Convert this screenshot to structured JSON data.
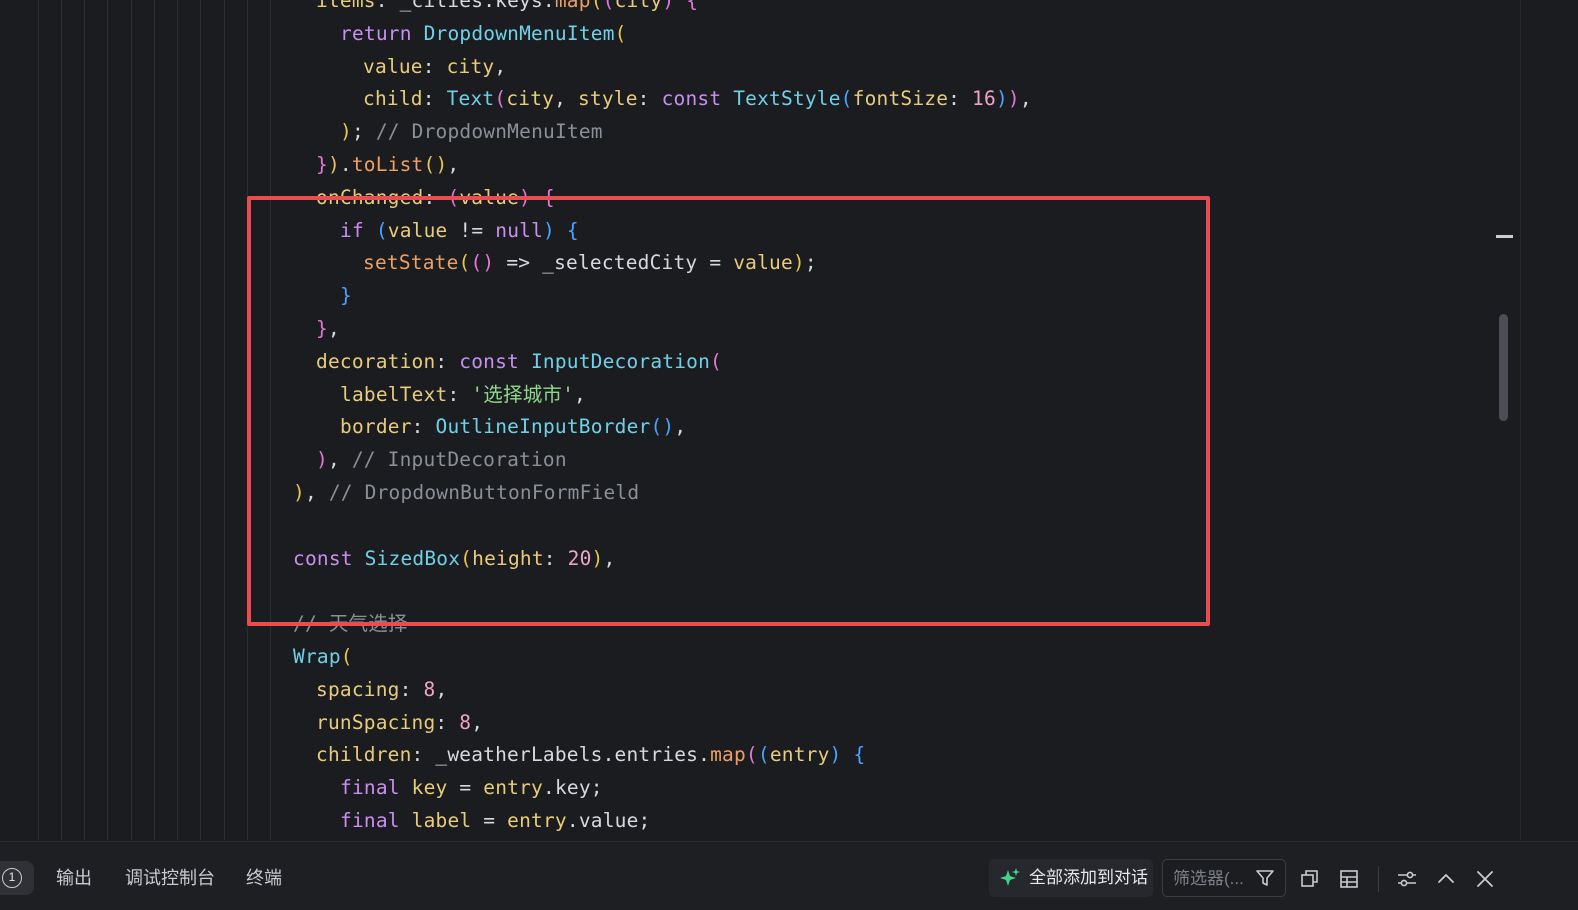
{
  "code_lines": [
    {
      "indent": 316,
      "tokens": [
        {
          "t": "items",
          "c": "prop"
        },
        {
          "t": ": ",
          "c": "id"
        },
        {
          "t": "_cities",
          "c": "id"
        },
        {
          "t": ".",
          "c": "id"
        },
        {
          "t": "keys",
          "c": "id"
        },
        {
          "t": ".",
          "c": "id"
        },
        {
          "t": "map",
          "c": "fn"
        },
        {
          "t": "(",
          "c": "p1"
        },
        {
          "t": "(",
          "c": "p2"
        },
        {
          "t": "city",
          "c": "prop"
        },
        {
          "t": ")",
          "c": "p2"
        },
        {
          "t": " ",
          "c": "id"
        },
        {
          "t": "{",
          "c": "p2"
        }
      ]
    },
    {
      "indent": 340,
      "tokens": [
        {
          "t": "return ",
          "c": "kw"
        },
        {
          "t": "DropdownMenuItem",
          "c": "ty"
        },
        {
          "t": "(",
          "c": "p1"
        }
      ]
    },
    {
      "indent": 363,
      "tokens": [
        {
          "t": "value",
          "c": "prop"
        },
        {
          "t": ": ",
          "c": "id"
        },
        {
          "t": "city",
          "c": "prop"
        },
        {
          "t": ",",
          "c": "id"
        }
      ]
    },
    {
      "indent": 363,
      "tokens": [
        {
          "t": "child",
          "c": "prop"
        },
        {
          "t": ": ",
          "c": "id"
        },
        {
          "t": "Text",
          "c": "ty"
        },
        {
          "t": "(",
          "c": "p2"
        },
        {
          "t": "city",
          "c": "prop"
        },
        {
          "t": ", ",
          "c": "id"
        },
        {
          "t": "style",
          "c": "prop"
        },
        {
          "t": ": ",
          "c": "id"
        },
        {
          "t": "const ",
          "c": "kw"
        },
        {
          "t": "TextStyle",
          "c": "ty"
        },
        {
          "t": "(",
          "c": "p3"
        },
        {
          "t": "fontSize",
          "c": "prop"
        },
        {
          "t": ": ",
          "c": "id"
        },
        {
          "t": "16",
          "c": "num"
        },
        {
          "t": ")",
          "c": "p3"
        },
        {
          "t": ")",
          "c": "p2"
        },
        {
          "t": ",",
          "c": "id"
        }
      ]
    },
    {
      "indent": 340,
      "tokens": [
        {
          "t": ")",
          "c": "p1"
        },
        {
          "t": "; ",
          "c": "id"
        },
        {
          "t": "// DropdownMenuItem",
          "c": "cm"
        }
      ]
    },
    {
      "indent": 316,
      "tokens": [
        {
          "t": "}",
          "c": "p2"
        },
        {
          "t": ")",
          "c": "p1"
        },
        {
          "t": ".",
          "c": "id"
        },
        {
          "t": "toList",
          "c": "fn"
        },
        {
          "t": "()",
          "c": "p1"
        },
        {
          "t": ",",
          "c": "id"
        }
      ]
    },
    {
      "indent": 316,
      "tokens": [
        {
          "t": "onChanged",
          "c": "prop"
        },
        {
          "t": ": ",
          "c": "id"
        },
        {
          "t": "(",
          "c": "p2"
        },
        {
          "t": "value",
          "c": "prop"
        },
        {
          "t": ")",
          "c": "p2"
        },
        {
          "t": " ",
          "c": "id"
        },
        {
          "t": "{",
          "c": "p2"
        }
      ]
    },
    {
      "indent": 340,
      "tokens": [
        {
          "t": "if ",
          "c": "kw"
        },
        {
          "t": "(",
          "c": "p3"
        },
        {
          "t": "value",
          "c": "prop"
        },
        {
          "t": " != ",
          "c": "id"
        },
        {
          "t": "null",
          "c": "kw"
        },
        {
          "t": ")",
          "c": "p3"
        },
        {
          "t": " ",
          "c": "id"
        },
        {
          "t": "{",
          "c": "p3"
        }
      ]
    },
    {
      "indent": 363,
      "tokens": [
        {
          "t": "setState",
          "c": "fn"
        },
        {
          "t": "(",
          "c": "p1"
        },
        {
          "t": "()",
          "c": "p2"
        },
        {
          "t": " => ",
          "c": "id"
        },
        {
          "t": "_selectedCity",
          "c": "id"
        },
        {
          "t": " = ",
          "c": "id"
        },
        {
          "t": "value",
          "c": "prop"
        },
        {
          "t": ")",
          "c": "p1"
        },
        {
          "t": ";",
          "c": "id"
        }
      ]
    },
    {
      "indent": 340,
      "tokens": [
        {
          "t": "}",
          "c": "p3"
        }
      ]
    },
    {
      "indent": 316,
      "tokens": [
        {
          "t": "}",
          "c": "p2"
        },
        {
          "t": ",",
          "c": "id"
        }
      ]
    },
    {
      "indent": 316,
      "tokens": [
        {
          "t": "decoration",
          "c": "prop"
        },
        {
          "t": ": ",
          "c": "id"
        },
        {
          "t": "const ",
          "c": "kw"
        },
        {
          "t": "InputDecoration",
          "c": "ty"
        },
        {
          "t": "(",
          "c": "p2"
        }
      ]
    },
    {
      "indent": 340,
      "tokens": [
        {
          "t": "labelText",
          "c": "prop"
        },
        {
          "t": ": ",
          "c": "id"
        },
        {
          "t": "'选择城市'",
          "c": "str"
        },
        {
          "t": ",",
          "c": "id"
        }
      ]
    },
    {
      "indent": 340,
      "tokens": [
        {
          "t": "border",
          "c": "prop"
        },
        {
          "t": ": ",
          "c": "id"
        },
        {
          "t": "OutlineInputBorder",
          "c": "ty"
        },
        {
          "t": "()",
          "c": "p3"
        },
        {
          "t": ",",
          "c": "id"
        }
      ]
    },
    {
      "indent": 316,
      "tokens": [
        {
          "t": ")",
          "c": "p2"
        },
        {
          "t": ", ",
          "c": "id"
        },
        {
          "t": "// InputDecoration",
          "c": "cm"
        }
      ]
    },
    {
      "indent": 293,
      "tokens": [
        {
          "t": ")",
          "c": "p1"
        },
        {
          "t": ", ",
          "c": "id"
        },
        {
          "t": "// DropdownButtonFormField",
          "c": "cm"
        }
      ]
    },
    {
      "indent": 293,
      "tokens": []
    },
    {
      "indent": 293,
      "tokens": [
        {
          "t": "const ",
          "c": "kw"
        },
        {
          "t": "SizedBox",
          "c": "ty"
        },
        {
          "t": "(",
          "c": "p1"
        },
        {
          "t": "height",
          "c": "prop"
        },
        {
          "t": ": ",
          "c": "id"
        },
        {
          "t": "20",
          "c": "num"
        },
        {
          "t": ")",
          "c": "p1"
        },
        {
          "t": ",",
          "c": "id"
        }
      ]
    },
    {
      "indent": 293,
      "tokens": []
    },
    {
      "indent": 293,
      "tokens": [
        {
          "t": "// 天气选择",
          "c": "cm"
        }
      ]
    },
    {
      "indent": 293,
      "tokens": [
        {
          "t": "Wrap",
          "c": "ty"
        },
        {
          "t": "(",
          "c": "p1"
        }
      ]
    },
    {
      "indent": 316,
      "tokens": [
        {
          "t": "spacing",
          "c": "prop"
        },
        {
          "t": ": ",
          "c": "id"
        },
        {
          "t": "8",
          "c": "num"
        },
        {
          "t": ",",
          "c": "id"
        }
      ]
    },
    {
      "indent": 316,
      "tokens": [
        {
          "t": "runSpacing",
          "c": "prop"
        },
        {
          "t": ": ",
          "c": "id"
        },
        {
          "t": "8",
          "c": "num"
        },
        {
          "t": ",",
          "c": "id"
        }
      ]
    },
    {
      "indent": 316,
      "tokens": [
        {
          "t": "children",
          "c": "prop"
        },
        {
          "t": ": ",
          "c": "id"
        },
        {
          "t": "_weatherLabels",
          "c": "id"
        },
        {
          "t": ".",
          "c": "id"
        },
        {
          "t": "entries",
          "c": "id"
        },
        {
          "t": ".",
          "c": "id"
        },
        {
          "t": "map",
          "c": "fn"
        },
        {
          "t": "(",
          "c": "p2"
        },
        {
          "t": "(",
          "c": "p3"
        },
        {
          "t": "entry",
          "c": "prop"
        },
        {
          "t": ")",
          "c": "p3"
        },
        {
          "t": " ",
          "c": "id"
        },
        {
          "t": "{",
          "c": "p3"
        }
      ]
    },
    {
      "indent": 340,
      "tokens": [
        {
          "t": "final ",
          "c": "kw"
        },
        {
          "t": "key",
          "c": "prop"
        },
        {
          "t": " = ",
          "c": "id"
        },
        {
          "t": "entry",
          "c": "prop"
        },
        {
          "t": ".",
          "c": "id"
        },
        {
          "t": "key",
          "c": "id"
        },
        {
          "t": ";",
          "c": "id"
        }
      ]
    },
    {
      "indent": 340,
      "tokens": [
        {
          "t": "final ",
          "c": "kw"
        },
        {
          "t": "label",
          "c": "prop"
        },
        {
          "t": " = ",
          "c": "id"
        },
        {
          "t": "entry",
          "c": "prop"
        },
        {
          "t": ".",
          "c": "id"
        },
        {
          "t": "value",
          "c": "id"
        },
        {
          "t": ";",
          "c": "id"
        }
      ]
    }
  ],
  "panel": {
    "badge": "1",
    "tabs": [
      "输出",
      "调试控制台",
      "终端"
    ],
    "add_to_chat": "全部添加到对话",
    "filter_placeholder": "筛选器(..."
  },
  "icons": {
    "sparkle": "sparkle-icon",
    "filter": "filter-icon",
    "copy": "copy-icon",
    "table": "table-icon",
    "settings": "settings-icon",
    "collapse": "chevron-up-icon",
    "close": "close-icon"
  },
  "colors": {
    "highlight": "#ec4b4f",
    "background": "#1b1c20"
  }
}
